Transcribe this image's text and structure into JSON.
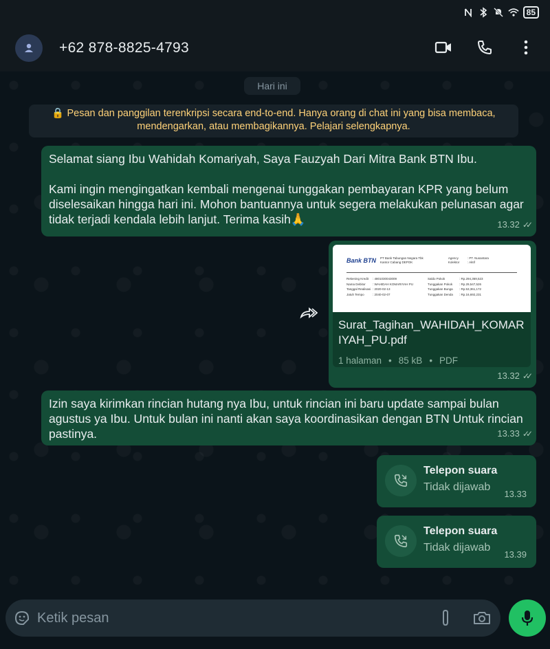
{
  "status_bar": {
    "battery": "85"
  },
  "header": {
    "contact": "+62 878-8825-4793"
  },
  "chat": {
    "date_chip": "Hari ini",
    "encryption_notice": "🔒 Pesan dan panggilan terenkripsi secara end-to-end. Hanya orang di chat ini yang bisa membaca, mendengarkan, atau membagikannya. Pelajari selengkapnya.",
    "messages": [
      {
        "text": "Selamat siang Ibu Wahidah Komariyah, Saya Fauzyah Dari Mitra Bank BTN Ibu.\n\nKami ingin mengingatkan kembali mengenai tunggakan pembayaran KPR yang belum diselesaikan hingga hari ini. Mohon bantuannya untuk segera melakukan pelunasan agar tidak terjadi kendala lebih lanjut. Terima kasih🙏",
        "time": "13.32"
      },
      {
        "document": {
          "name": "Surat_Tagihan_WAHIDAH_KOMARIYAH_PU.pdf",
          "pages": "1 halaman",
          "size": "85 kB",
          "type": "PDF",
          "preview": {
            "bank_logo": "Bank BTN",
            "bank_name": "PT Bank Tabungan Negara Tbk",
            "branch": "Kantor Cabang DEPOK",
            "agency_label": "Agency",
            "agency_value": ": PT. Nusantara",
            "collector_label": "Kolektor",
            "collector_value": ": Aktif",
            "rows_left": [
              [
                "Rekening Kredit",
                ": 4801030043009"
              ],
              [
                "Nama Debitor",
                ": WAHIDAH KOMARIYAH PU"
              ],
              [
                "Tanggal Realisasi",
                ": 2020-02-13"
              ],
              [
                "Jatuh Tempo",
                ": 2040-02-07"
              ]
            ],
            "rows_right": [
              [
                "Saldo Pokok",
                ": Rp.294,369,523"
              ],
              [
                "Tunggakan Pokok",
                ": Rp.29,547,526"
              ],
              [
                "Tunggakan Bunga",
                ": Rp.53,361,172"
              ],
              [
                "Tunggakan Denda",
                ": Rp.16,692,231"
              ]
            ]
          }
        },
        "time": "13.32"
      },
      {
        "text": "Izin saya kirimkan rincian hutang nya Ibu, untuk rincian ini baru update sampai bulan agustus ya Ibu. Untuk bulan ini nanti akan saya koordinasikan dengan BTN Untuk rincian pastinya.",
        "time": "13.33"
      },
      {
        "call_title": "Telepon suara",
        "call_status": "Tidak dijawab",
        "time": "13.33"
      },
      {
        "call_title": "Telepon suara",
        "call_status": "Tidak dijawab",
        "time": "13.39"
      }
    ]
  },
  "composer": {
    "placeholder": "Ketik pesan"
  },
  "colors": {
    "bubble": "#144d37",
    "accent": "#21c063",
    "notice": "#ffd279",
    "background": "#0b141a"
  }
}
